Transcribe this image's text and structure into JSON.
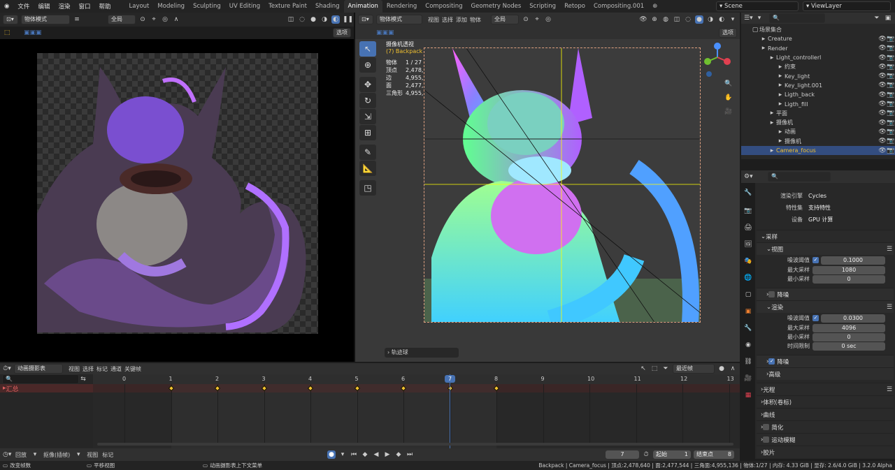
{
  "menu": [
    "文件",
    "编辑",
    "渲染",
    "窗口",
    "帮助"
  ],
  "workspaces": [
    "Layout",
    "Modeling",
    "Sculpting",
    "UV Editing",
    "Texture Paint",
    "Shading",
    "Animation",
    "Rendering",
    "Compositing",
    "Geometry Nodes",
    "Scripting",
    "Retopo",
    "Compositing.001"
  ],
  "active_workspace": "Animation",
  "scene": "Scene",
  "view_layer": "ViewLayer",
  "left_view": {
    "mode": "物体模式",
    "global": "全局",
    "options": "选项"
  },
  "right_view": {
    "mode": "物体模式",
    "menus": [
      "视图",
      "选择",
      "添加",
      "物体"
    ],
    "global": "全局",
    "options": "选项",
    "title": "摄像机透视",
    "subtitle": "(7) Backpack | Camera_focus",
    "stats": [
      [
        "物体",
        "1 / 27"
      ],
      [
        "顶点",
        "2,478,640"
      ],
      [
        "边",
        "4,955,208"
      ],
      [
        "面",
        "2,477,544"
      ],
      [
        "三角形",
        "4,955,136"
      ]
    ],
    "trackball": "轨迹球"
  },
  "outliner": {
    "root": "场景集合",
    "rows": [
      {
        "label": "Creature",
        "indent": 1
      },
      {
        "label": "Render",
        "indent": 1
      },
      {
        "label": "Light_controllerl",
        "indent": 2
      },
      {
        "label": "约束",
        "indent": 3
      },
      {
        "label": "Key_light",
        "indent": 3
      },
      {
        "label": "Key_light.001",
        "indent": 3
      },
      {
        "label": "Ligth_back",
        "indent": 3
      },
      {
        "label": "Ligth_fill",
        "indent": 3
      },
      {
        "label": "平面",
        "indent": 2
      },
      {
        "label": "摄像机",
        "indent": 2
      },
      {
        "label": "动画",
        "indent": 3
      },
      {
        "label": "摄像机",
        "indent": 3
      },
      {
        "label": "Camera_focus",
        "indent": 2,
        "selected": true
      }
    ]
  },
  "props": {
    "engine_label": "渲染引擎",
    "engine": "Cycles",
    "feature_label": "特性集",
    "feature": "支持特性",
    "device_label": "设备",
    "device": "GPU 计算",
    "sampling": "采样",
    "viewport": "视图",
    "noise_label": "噪波阈值",
    "viewport_noise": "0.1000",
    "max_label": "最大采样",
    "viewport_max": "1080",
    "min_label": "最小采样",
    "viewport_min": "0",
    "denoise": "降噪",
    "render": "渲染",
    "render_noise": "0.0300",
    "render_max": "4096",
    "render_min": "0",
    "time_label": "时间限制",
    "render_time": "0 sec",
    "advanced": "高级",
    "sections": [
      "光程",
      "体积(卷标)",
      "曲线",
      "简化",
      "运动模糊",
      "胶片"
    ]
  },
  "dopesheet": {
    "editor": "动画摄影表",
    "menus": [
      "视图",
      "选择",
      "标记",
      "通道",
      "关键帧"
    ],
    "snap": "最近帧",
    "channel": "汇总",
    "frames": [
      "0",
      "1",
      "2",
      "3",
      "4",
      "5",
      "6",
      "7",
      "8",
      "9",
      "10",
      "11",
      "12",
      "13"
    ],
    "current": "7",
    "key_frames": [
      1,
      2,
      3,
      4,
      5,
      6,
      7,
      8
    ]
  },
  "playback": {
    "playback": "回放",
    "keying": "抠像(插帧)",
    "view": "视图",
    "marker": "标记",
    "frame": "7",
    "start_label": "起始",
    "start": "1",
    "end_label": "结束点",
    "end": "8"
  },
  "status": {
    "left": "改变帧数",
    "mid": "平移视图",
    "ctx": "动画摄影表上下文菜单",
    "right": "Backpack | Camera_focus | 顶点:2,478,640 | 面:2,477,544 | 三角面:4,955,136 | 物体:1/27 | 内存: 4.33 GiB | 显存: 2.6/4.0 GiB | 3.2.0 Alpha"
  },
  "colors": {
    "accent": "#4772b3",
    "key": "#f0c030",
    "selected_row": "#334d80"
  }
}
